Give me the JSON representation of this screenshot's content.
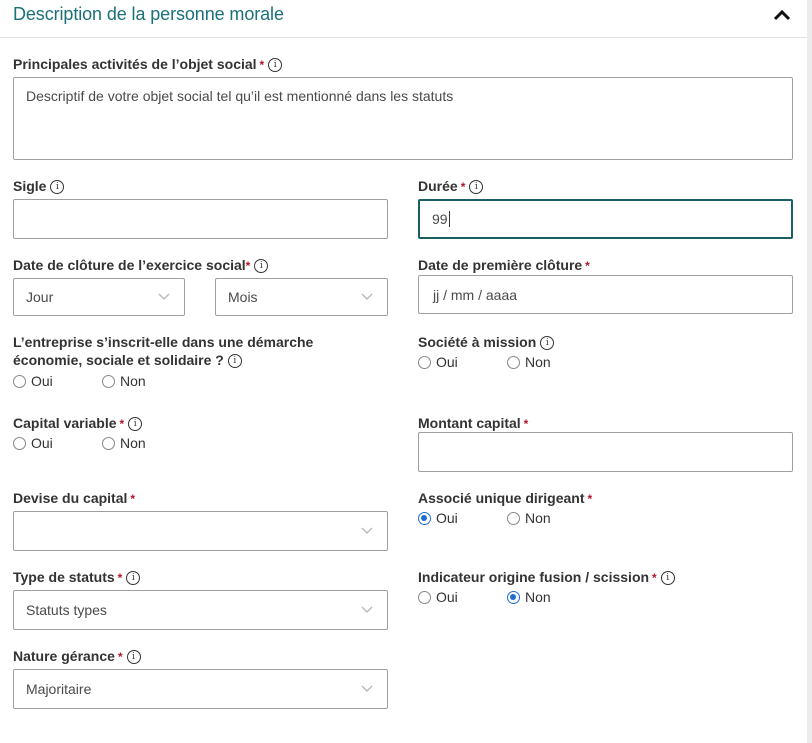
{
  "section": {
    "title": "Description de la personne morale",
    "collapse_icon": "chevron-up-icon"
  },
  "fields": {
    "activites": {
      "label": "Principales activités de l’objet social",
      "required": "*",
      "placeholder": "Descriptif de votre objet social tel qu’il est mentionné dans les statuts",
      "value": ""
    },
    "sigle": {
      "label": "Sigle",
      "value": ""
    },
    "duree": {
      "label": "Durée",
      "required": "*",
      "value": "99"
    },
    "date_cloture_exercice": {
      "label": "Date de clôture de l’exercice social",
      "required": "*",
      "jour": "Jour",
      "mois": "Mois"
    },
    "date_premiere_cloture": {
      "label": "Date de première clôture",
      "required": "*",
      "placeholder": "jj / mm / aaaa"
    },
    "ess": {
      "label": "L’entreprise s’inscrit-elle dans une démarche économie, sociale et solidaire ?",
      "options": [
        "Oui",
        "Non"
      ],
      "selected": null
    },
    "societe_mission": {
      "label": "Société à mission",
      "options": [
        "Oui",
        "Non"
      ],
      "selected": null
    },
    "capital_variable": {
      "label": "Capital variable",
      "required": "*",
      "options": [
        "Oui",
        "Non"
      ],
      "selected": null
    },
    "montant_capital": {
      "label": "Montant capital",
      "required": "*",
      "value": ""
    },
    "devise_capital": {
      "label": "Devise du capital",
      "required": "*",
      "value": ""
    },
    "associe_unique": {
      "label": "Associé unique dirigeant",
      "required": "*",
      "options": [
        "Oui",
        "Non"
      ],
      "selected": "Oui"
    },
    "type_statuts": {
      "label": "Type de statuts",
      "required": "*",
      "value": "Statuts types"
    },
    "fusion_scission": {
      "label": "Indicateur origine fusion / scission",
      "required": "*",
      "options": [
        "Oui",
        "Non"
      ],
      "selected": "Non"
    },
    "nature_gerance": {
      "label": "Nature gérance",
      "required": "*",
      "value": "Majoritaire"
    }
  },
  "colors": {
    "title": "#1b7079",
    "focus_border": "#1b5f66",
    "required": "#b3142c",
    "radio_selected": "#1c6fd1"
  }
}
